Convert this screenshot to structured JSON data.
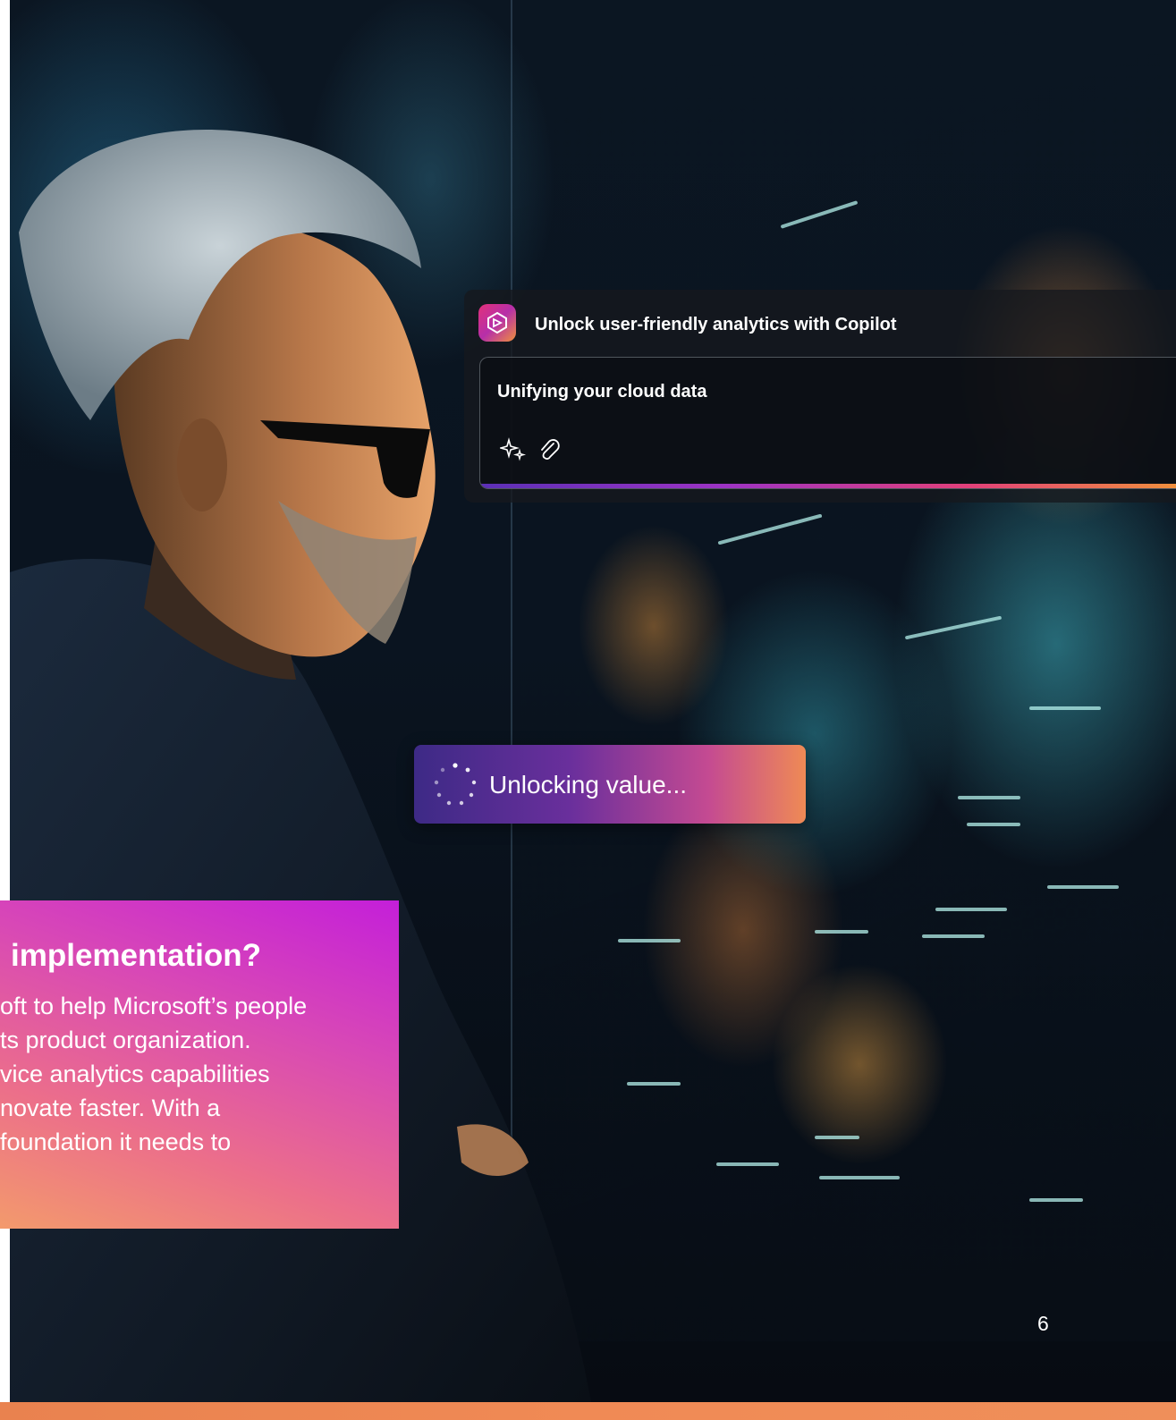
{
  "copilot_panel": {
    "title": "Unlock user-friendly analytics with Copilot",
    "prompt_text": "Unifying your cloud data"
  },
  "status_pill": {
    "text": "Unlocking value..."
  },
  "callout": {
    "heading": "implementation?",
    "body_lines": [
      "oft to help Microsoft’s people",
      "ts product organization.",
      "vice analytics capabilities",
      "novate faster. With a",
      "foundation it needs to"
    ]
  },
  "page_number": "6",
  "colors": {
    "accent_purple": "#c41fd9",
    "accent_orange": "#f39a6c",
    "panel_dark": "#16181e"
  },
  "icons": [
    "copilot-logo-icon",
    "sparkle-icon",
    "paperclip-icon",
    "loading-spinner-icon"
  ]
}
